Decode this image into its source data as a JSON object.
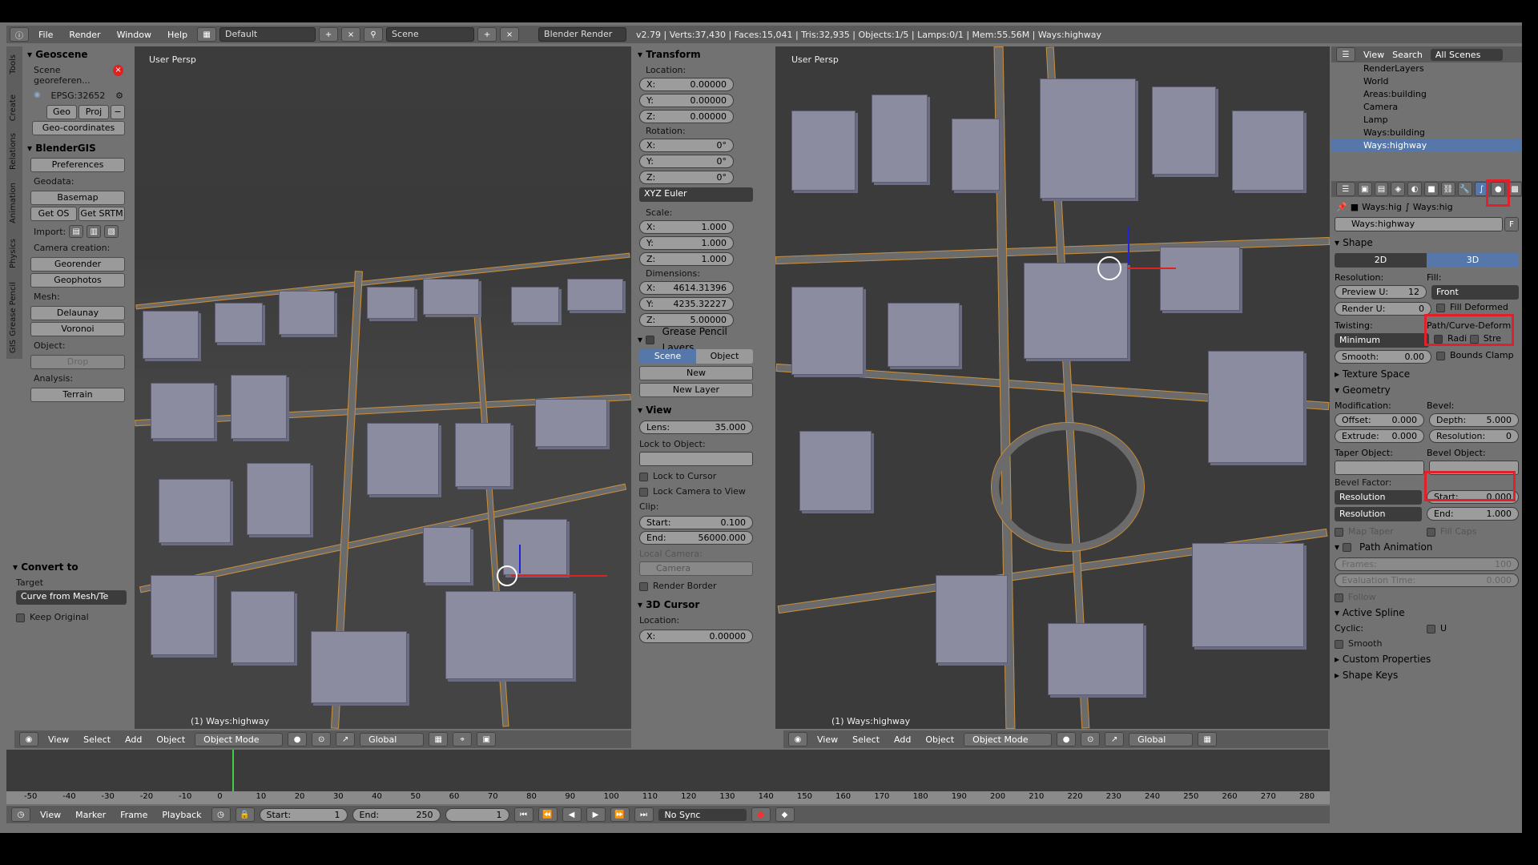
{
  "topbar": {
    "menus": [
      "File",
      "Render",
      "Window",
      "Help"
    ],
    "layout": "Default",
    "scene": "Scene",
    "engine": "Blender Render",
    "stats": "v2.79 | Verts:37,430 | Faces:15,041 | Tris:32,935 | Objects:1/5 | Lamps:0/1 | Mem:55.56M | Ways:highway"
  },
  "left_tabs": [
    "Tools",
    "Create",
    "Relations",
    "Animation",
    "Physics",
    "Grease Pencil",
    "GIS"
  ],
  "geoscene": {
    "title": "Geoscene",
    "georef_label": "Scene georeferen...",
    "epsg": "EPSG:32652",
    "geo_btn": "Geo",
    "proj_btn": "Proj",
    "geocoords_btn": "Geo-coordinates"
  },
  "blendergis": {
    "title": "BlenderGIS",
    "preferences": "Preferences",
    "geodata_label": "Geodata:",
    "basemap": "Basemap",
    "get_os": "Get OS",
    "get_srtm": "Get SRTM",
    "import_label": "Import:",
    "camera_label": "Camera creation:",
    "georender": "Georender",
    "geophotos": "Geophotos",
    "mesh_label": "Mesh:",
    "delaunay": "Delaunay",
    "voronoi": "Voronoi",
    "object_label": "Object:",
    "drop": "Drop",
    "analysis_label": "Analysis:",
    "terrain": "Terrain"
  },
  "convert": {
    "title": "Convert to",
    "target_label": "Target",
    "target_value": "Curve from Mesh/Te",
    "keep_original": "Keep Original"
  },
  "viewport_left": {
    "label": "User Persp",
    "object": "(1) Ways:highway"
  },
  "viewport_right": {
    "label": "User Persp",
    "object": "(1) Ways:highway"
  },
  "transform": {
    "title": "Transform",
    "location_label": "Location:",
    "location": [
      {
        "axis": "X:",
        "value": "0.00000"
      },
      {
        "axis": "Y:",
        "value": "0.00000"
      },
      {
        "axis": "Z:",
        "value": "0.00000"
      }
    ],
    "rotation_label": "Rotation:",
    "rotation": [
      {
        "axis": "X:",
        "value": "0°"
      },
      {
        "axis": "Y:",
        "value": "0°"
      },
      {
        "axis": "Z:",
        "value": "0°"
      }
    ],
    "rotation_mode": "XYZ Euler",
    "scale_label": "Scale:",
    "scale": [
      {
        "axis": "X:",
        "value": "1.000"
      },
      {
        "axis": "Y:",
        "value": "1.000"
      },
      {
        "axis": "Z:",
        "value": "1.000"
      }
    ],
    "dimensions_label": "Dimensions:",
    "dimensions": [
      {
        "axis": "X:",
        "value": "4614.31396"
      },
      {
        "axis": "Y:",
        "value": "4235.32227"
      },
      {
        "axis": "Z:",
        "value": "5.00000"
      }
    ]
  },
  "grease": {
    "title": "Grease Pencil Layers",
    "scene": "Scene",
    "object": "Object",
    "new": "New",
    "new_layer": "New Layer"
  },
  "view": {
    "title": "View",
    "lens_label": "Lens:",
    "lens": "35.000",
    "lock_label": "Lock to Object:",
    "lock_cursor": "Lock to Cursor",
    "lock_camera": "Lock Camera to View",
    "clip_label": "Clip:",
    "start_label": "Start:",
    "start": "0.100",
    "end_label": "End:",
    "end": "56000.000",
    "local_camera_label": "Local Camera:",
    "camera": "Camera",
    "render_border": "Render Border"
  },
  "cursor": {
    "title": "3D Cursor",
    "location_label": "Location:",
    "x_label": "X:",
    "x": "0.00000"
  },
  "outliner": {
    "view": "View",
    "search": "Search",
    "filter": "All Scenes",
    "items": [
      "RenderLayers",
      "World",
      "Areas:building",
      "Camera",
      "Lamp",
      "Ways:building",
      "Ways:highway"
    ]
  },
  "props": {
    "breadcrumb_a": "Ways:hig",
    "breadcrumb_b": "Ways:hig",
    "name": "Ways:highway",
    "f": "F",
    "shape_title": "Shape",
    "tab_2d": "2D",
    "tab_3d": "3D",
    "resolution_label": "Resolution:",
    "fill_label": "Fill:",
    "preview_u": "Preview U:",
    "preview_u_val": "12",
    "render_u": "Render U:",
    "render_u_val": "0",
    "fill_value": "Front",
    "fill_deformed": "Fill Deformed",
    "twisting_label": "Twisting:",
    "path_label": "Path/Curve-Deform:",
    "twist_value": "Minimum",
    "radius": "Radi",
    "stretch": "Stre",
    "smooth_label": "Smooth:",
    "smooth_val": "0.00",
    "bounds_clamp": "Bounds Clamp",
    "texture_space": "Texture Space",
    "geometry": "Geometry",
    "modification_label": "Modification:",
    "bevel_label": "Bevel:",
    "offset_label": "Offset:",
    "offset": "0.000",
    "depth_label": "Depth:",
    "depth": "5.000",
    "extrude_label": "Extrude:",
    "extrude": "0.000",
    "bev_res_label": "Resolution:",
    "bev_res": "0",
    "taper_label": "Taper Object:",
    "bevel_obj_label": "Bevel Object:",
    "bevel_factor_label": "Bevel Factor:",
    "bf_mode1": "Resolution",
    "bf_mode2": "Resolution",
    "bf_start_label": "Start:",
    "bf_start": "0.000",
    "bf_end_label": "End:",
    "bf_end": "1.000",
    "map_taper": "Map Taper",
    "fill_caps": "Fill Caps",
    "path_anim": "Path Animation",
    "frames_label": "Frames:",
    "frames": "100",
    "eval_label": "Evaluation Time:",
    "eval": "0.000",
    "follow": "Follow",
    "active_spline": "Active Spline",
    "cyclic_label": "Cyclic:",
    "cyclic_u": "U",
    "smooth": "Smooth",
    "custom_props": "Custom Properties",
    "shape_keys": "Shape Keys"
  },
  "view3d_toolbar": {
    "view": "View",
    "select": "Select",
    "add": "Add",
    "object": "Object",
    "mode": "Object Mode",
    "orientation": "Global"
  },
  "timeline": {
    "ticks": [
      "-50",
      "-40",
      "-30",
      "-20",
      "-10",
      "0",
      "10",
      "20",
      "30",
      "40",
      "50",
      "60",
      "70",
      "80",
      "90",
      "100",
      "110",
      "120",
      "130",
      "140",
      "150",
      "160",
      "170",
      "180",
      "190",
      "200",
      "210",
      "220",
      "230",
      "240",
      "250",
      "260",
      "270",
      "280"
    ],
    "view": "View",
    "marker": "Marker",
    "frame": "Frame",
    "playback": "Playback",
    "start_label": "Start:",
    "start": "1",
    "end_label": "End:",
    "end": "250",
    "current": "1",
    "sync": "No Sync"
  },
  "colors": {
    "highlight": "#e0202a",
    "selected": "#5577aa",
    "viewport_bg": "#3b3b3b",
    "building": "#8c8ca0",
    "road_outline": "#c88e3a"
  }
}
